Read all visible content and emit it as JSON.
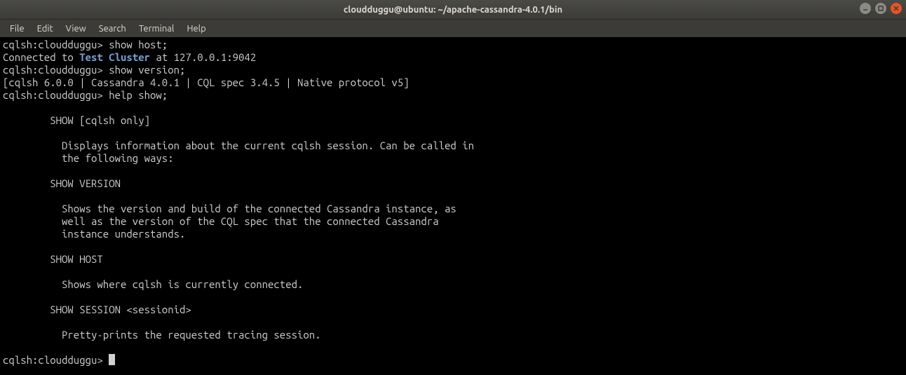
{
  "titlebar": {
    "text": "cloudduggu@ubuntu: ~/apache-cassandra-4.0.1/bin"
  },
  "menubar": {
    "items": [
      "File",
      "Edit",
      "View",
      "Search",
      "Terminal",
      "Help"
    ]
  },
  "terminal": {
    "prompt": "cqlsh:cloudduggu> ",
    "lines": {
      "l0_prompt": "cqlsh:cloudduggu> ",
      "l0_cmd": "show host;",
      "l1a": "Connected to ",
      "l1b_kw": "Test Cluster",
      "l1c": " at 127.0.0.1:9042",
      "l2_prompt": "cqlsh:cloudduggu> ",
      "l2_cmd": "show version;",
      "l3": "[cqlsh 6.0.0 | Cassandra 4.0.1 | CQL spec 3.4.5 | Native protocol v5]",
      "l4_prompt": "cqlsh:cloudduggu> ",
      "l4_cmd": "help show;",
      "l5": "",
      "l6": "        SHOW [cqlsh only]",
      "l7": "",
      "l8": "          Displays information about the current cqlsh session. Can be called in",
      "l9": "          the following ways:",
      "l10": "",
      "l11": "        SHOW VERSION",
      "l12": "",
      "l13": "          Shows the version and build of the connected Cassandra instance, as",
      "l14": "          well as the version of the CQL spec that the connected Cassandra",
      "l15": "          instance understands.",
      "l16": "",
      "l17": "        SHOW HOST",
      "l18": "",
      "l19": "          Shows where cqlsh is currently connected.",
      "l20": "",
      "l21": "        SHOW SESSION <sessionid>",
      "l22": "",
      "l23": "          Pretty-prints the requested tracing session.",
      "l24": "",
      "l25_prompt": "cqlsh:cloudduggu> "
    }
  }
}
